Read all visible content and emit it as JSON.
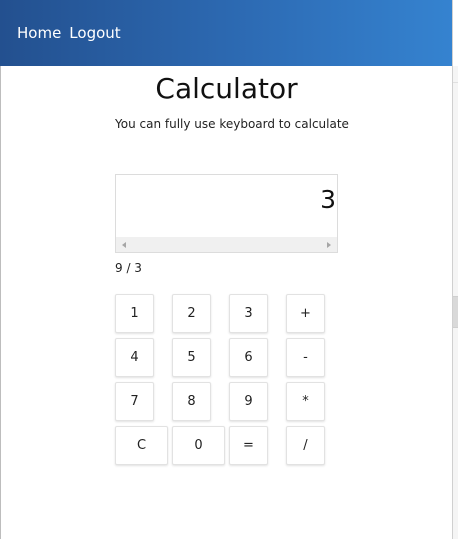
{
  "nav": {
    "home_label": "Home",
    "logout_label": "Logout"
  },
  "page": {
    "title": "Calculator",
    "subtitle": "You can fully use keyboard to calculate"
  },
  "display": {
    "value": "3",
    "expression": "9 / 3"
  },
  "keys": {
    "k1": "1",
    "k2": "2",
    "k3": "3",
    "plus": "+",
    "k4": "4",
    "k5": "5",
    "k6": "6",
    "minus": "-",
    "k7": "7",
    "k8": "8",
    "k9": "9",
    "multiply": "*",
    "clear": "C",
    "k0": "0",
    "equals": "=",
    "divide": "/"
  },
  "colors": {
    "navbar_start": "#23508f",
    "navbar_end": "#3583d0"
  }
}
